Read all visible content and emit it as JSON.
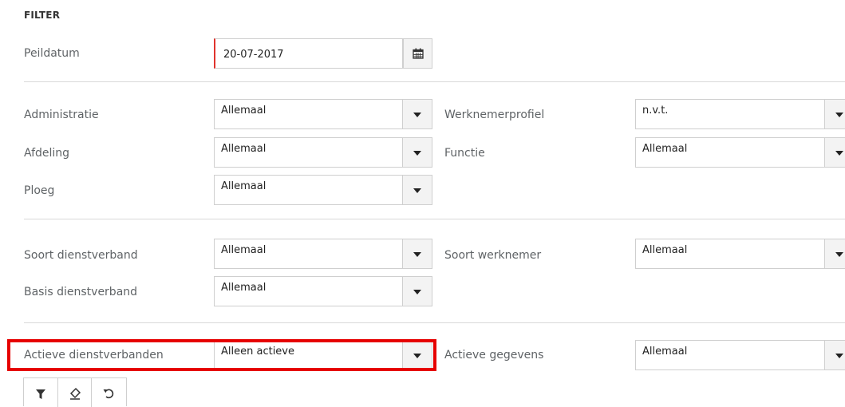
{
  "filter": {
    "title": "FILTER",
    "peildatum": {
      "label": "Peildatum",
      "value": "20-07-2017",
      "icon": "calendar-icon"
    },
    "section1": {
      "administratie": {
        "label": "Administratie",
        "value": "Allemaal"
      },
      "werknemerprofiel": {
        "label": "Werknemerprofiel",
        "value": "n.v.t."
      },
      "afdeling": {
        "label": "Afdeling",
        "value": "Allemaal"
      },
      "functie": {
        "label": "Functie",
        "value": "Allemaal"
      },
      "ploeg": {
        "label": "Ploeg",
        "value": "Allemaal"
      }
    },
    "section2": {
      "soort_dienstverband": {
        "label": "Soort dienstverband",
        "value": "Allemaal"
      },
      "soort_werknemer": {
        "label": "Soort werknemer",
        "value": "Allemaal"
      },
      "basis_dienstverband": {
        "label": "Basis dienstverband",
        "value": "Allemaal"
      }
    },
    "section3": {
      "actieve_dienstverbanden": {
        "label": "Actieve dienstverbanden",
        "value": "Alleen actieve"
      },
      "actieve_gegevens": {
        "label": "Actieve gegevens",
        "value": "Allemaal"
      }
    },
    "toolbar": {
      "buttons": [
        {
          "icon": "filter-icon"
        },
        {
          "icon": "eraser-icon"
        },
        {
          "icon": "undo-icon"
        }
      ]
    },
    "colors": {
      "required_marker": "#e0332d",
      "highlight": "#e60000"
    }
  }
}
